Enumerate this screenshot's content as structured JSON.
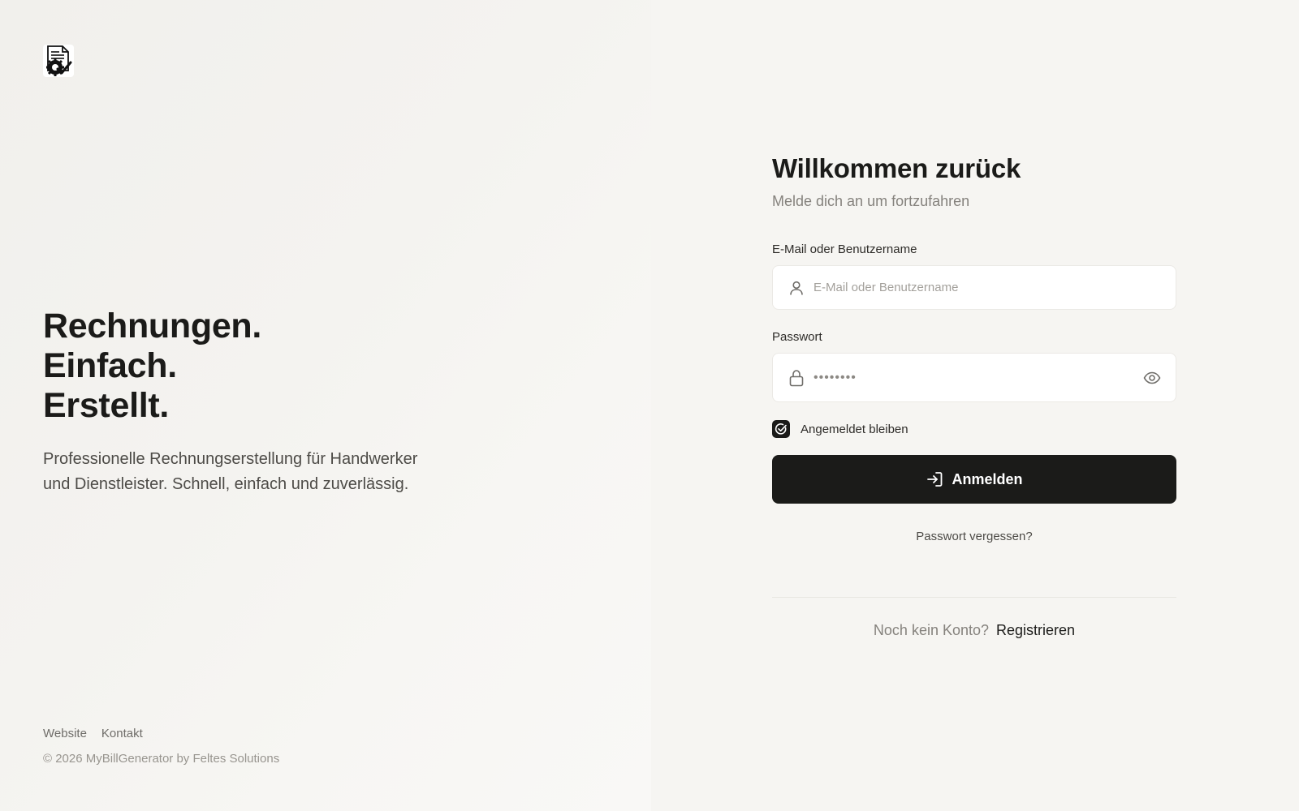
{
  "brand": {
    "logo_icon": "invoice-gear-check-icon"
  },
  "hero": {
    "headline_lines": [
      "Rechnungen.",
      "Einfach.",
      "Erstellt."
    ],
    "tagline": "Professionelle Rechnungserstellung für Handwerker und Dienstleister. Schnell, einfach und zuverlässig."
  },
  "footer": {
    "links": [
      "Website",
      "Kontakt"
    ],
    "copyright": "© 2026 MyBillGenerator by Feltes Solutions"
  },
  "login": {
    "title": "Willkommen zurück",
    "subtitle": "Melde dich an um fortzufahren",
    "email_label": "E-Mail oder Benutzername",
    "email_placeholder": "E-Mail oder Benutzername",
    "email_value": "",
    "email_icon": "user-icon",
    "password_label": "Passwort",
    "password_value": "••••••••",
    "password_icon": "lock-icon",
    "password_toggle_icon": "eye-icon",
    "remember_label": "Angemeldet bleiben",
    "remember_checked": true,
    "submit_label": "Anmelden",
    "submit_icon": "login-arrow-icon",
    "forgot_label": "Passwort vergessen?",
    "signup_prompt": "Noch kein Konto?",
    "signup_link": "Registrieren"
  },
  "colors": {
    "primary": "#1b1b19",
    "background": "#f6f5f2",
    "muted_text": "#85827d"
  }
}
